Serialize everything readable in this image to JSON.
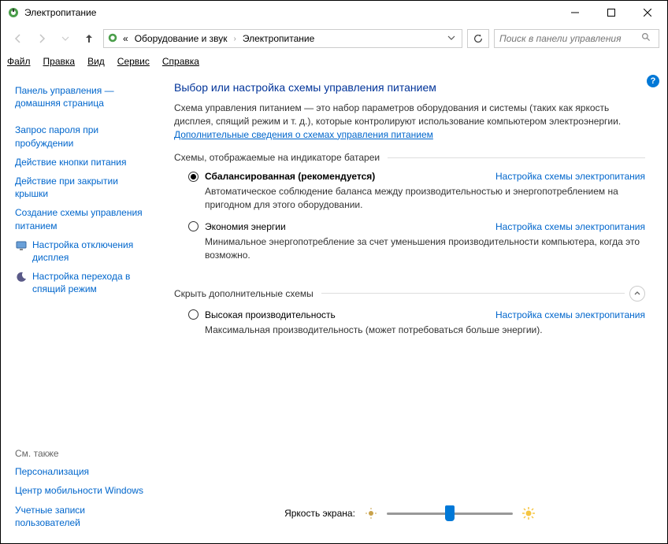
{
  "window": {
    "title": "Электропитание"
  },
  "nav": {
    "crumb0": "«",
    "crumb1": "Оборудование и звук",
    "crumb2": "Электропитание"
  },
  "search": {
    "placeholder": "Поиск в панели управления"
  },
  "menu": {
    "file": "Файл",
    "edit": "Правка",
    "view": "Вид",
    "service": "Сервис",
    "help": "Справка"
  },
  "sidebar": {
    "home1": "Панель управления —",
    "home2": "домашняя страница",
    "wakepwd1": "Запрос пароля при",
    "wakepwd2": "пробуждении",
    "powerbtn": "Действие кнопки питания",
    "lid1": "Действие при закрытии",
    "lid2": "крышки",
    "create1": "Создание схемы управления",
    "create2": "питанием",
    "display1": "Настройка отключения",
    "display2": "дисплея",
    "sleep1": "Настройка перехода в",
    "sleep2": "спящий режим",
    "seealso": "См. также",
    "personalization": "Персонализация",
    "mobility": "Центр мобильности Windows",
    "accounts1": "Учетные записи",
    "accounts2": "пользователей"
  },
  "main": {
    "heading": "Выбор или настройка схемы управления питанием",
    "intro": "Схема управления питанием — это набор параметров оборудования и системы (таких как яркость дисплея, спящий режим и т. д.), которые контролируют использование компьютером электроэнергии. ",
    "introlink": "Дополнительные сведения о схемах управления питанием",
    "group1": "Схемы, отображаемые на индикаторе батареи",
    "plan1name": "Сбалансированная (рекомендуется)",
    "plan1desc": "Автоматическое соблюдение баланса между производительностью и энергопотреблением на пригодном для этого оборудовании.",
    "plan2name": "Экономия энергии",
    "plan2desc": "Минимальное энергопотребление за счет уменьшения производительности компьютера, когда это возможно.",
    "settingslink": "Настройка схемы электропитания",
    "group2": "Скрыть дополнительные схемы",
    "plan3name": "Высокая производительность",
    "plan3desc": "Максимальная производительность (может потребоваться больше энергии).",
    "brightness": "Яркость экрана:"
  }
}
